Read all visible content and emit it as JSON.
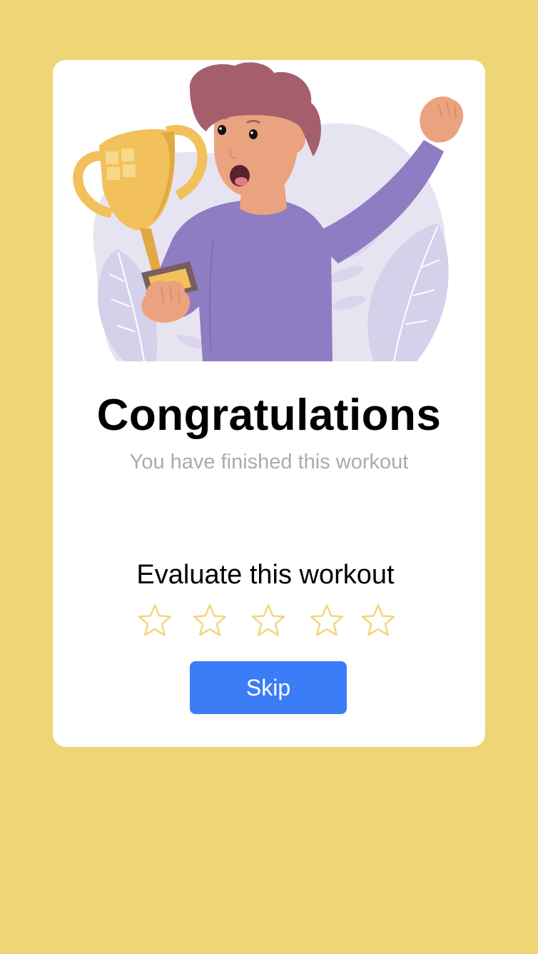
{
  "screen": {
    "background_color": "#EED575",
    "card_color": "#FFFFFF"
  },
  "illustration": {
    "icon": "trophy-celebration-illustration",
    "colors": {
      "shirt": "#8E7DC2",
      "hair": "#A55F6C",
      "skin": "#EBA27E",
      "trophy": "#F2C15C",
      "leaves": "#D6D1EA"
    }
  },
  "congrats": {
    "title": "Congratulations",
    "subtitle": "You have finished this workout"
  },
  "rating": {
    "label": "Evaluate this workout",
    "max": 5,
    "value": 0,
    "star_color": "#F0D67E",
    "star_icon": "star-outline-icon"
  },
  "actions": {
    "skip_label": "Skip",
    "skip_color": "#3A7DF6"
  }
}
